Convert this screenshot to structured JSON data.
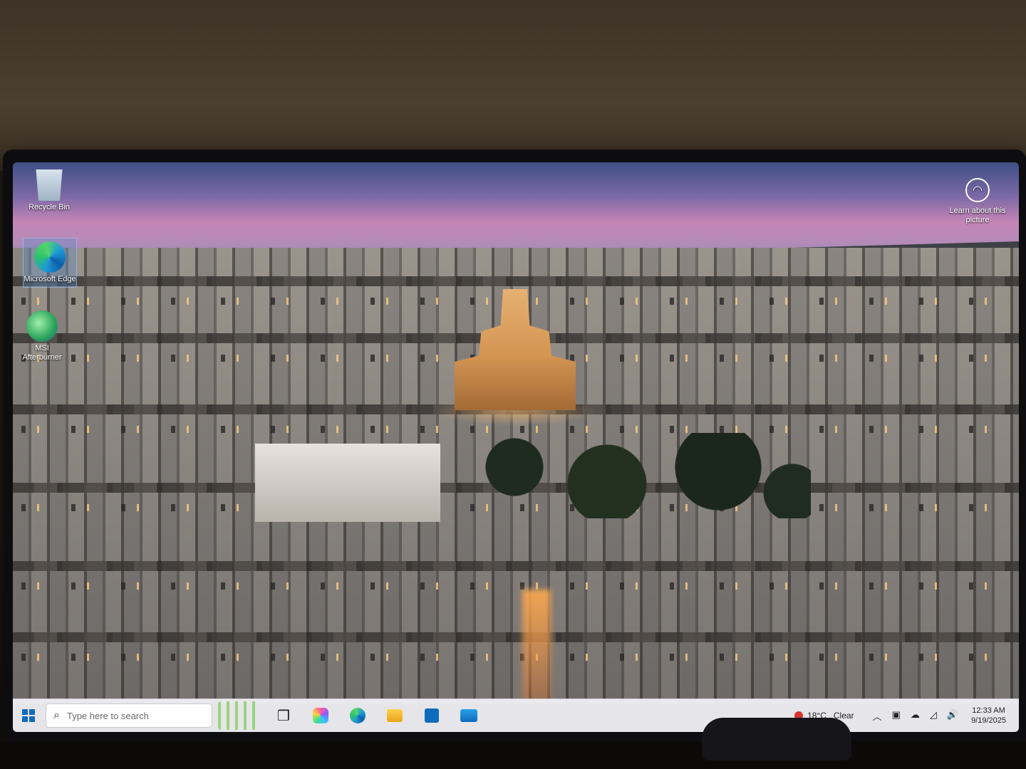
{
  "desktop": {
    "icons": [
      {
        "label": "Recycle Bin",
        "icon": "recycle-bin-icon"
      },
      {
        "label": "Microsoft Edge",
        "icon": "edge-icon"
      },
      {
        "label": "MSI Afterburner",
        "icon": "msi-afterburner-icon"
      }
    ],
    "learn_about": {
      "label": "Learn about this picture",
      "icon": "camera-icon"
    }
  },
  "taskbar": {
    "search_placeholder": "Type here to search",
    "apps": [
      "task-view",
      "copilot",
      "edge",
      "file-explorer",
      "microsoft-store",
      "mail"
    ],
    "weather": {
      "temp": "18°C",
      "condition": "Clear"
    },
    "clock": {
      "time": "12:33 AM",
      "date": "9/19/2025"
    }
  }
}
